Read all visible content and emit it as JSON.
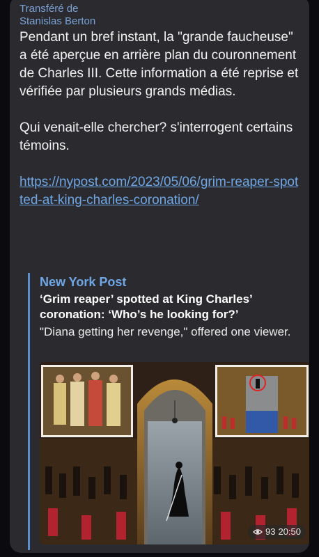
{
  "forward": {
    "line1": "Transféré de",
    "line2": "Stanislas Berton"
  },
  "message": {
    "para1": "Pendant un bref instant, la \"grande faucheuse\" a été aperçue en arrière plan du couronnement de Charles III. Cette information a été reprise et vérifiée par plusieurs grands médias.",
    "para2": "Qui venait-elle chercher? s'interrogent certains témoins.",
    "link": "https://nypost.com/2023/05/06/grim-reaper-spotted-at-king-charles-coronation/"
  },
  "preview": {
    "site": "New York Post",
    "title": "‘Grim reaper’ spotted at King Charles’ coronation: ‘Who’s he looking for?’",
    "description": "\"Diana getting her revenge,\" offered one viewer."
  },
  "meta": {
    "views": "93",
    "time": "20:50"
  },
  "colors": {
    "bubble": "#2b2b2f",
    "link": "#6fa7e6",
    "accent_bar": "#5a8fd0"
  },
  "icons": {
    "views": "eye-icon"
  }
}
